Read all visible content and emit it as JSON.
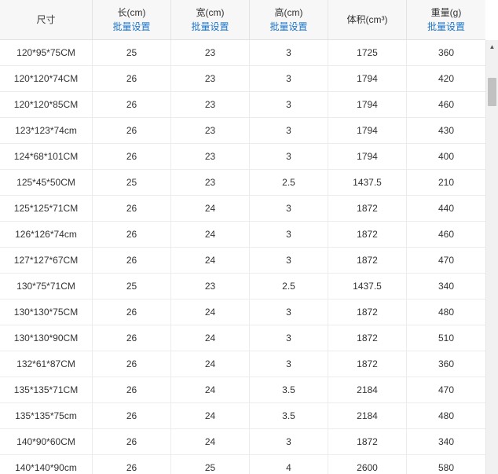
{
  "table": {
    "headers": [
      {
        "title": "尺寸",
        "link": ""
      },
      {
        "title": "长(cm)",
        "link": "批量设置"
      },
      {
        "title": "宽(cm)",
        "link": "批量设置"
      },
      {
        "title": "高(cm)",
        "link": "批量设置"
      },
      {
        "title": "体积(cm³)",
        "link": ""
      },
      {
        "title": "重量(g)",
        "link": "批量设置"
      }
    ],
    "rows": [
      [
        "120*95*75CM",
        "25",
        "23",
        "3",
        "1725",
        "360"
      ],
      [
        "120*120*74CM",
        "26",
        "23",
        "3",
        "1794",
        "420"
      ],
      [
        "120*120*85CM",
        "26",
        "23",
        "3",
        "1794",
        "460"
      ],
      [
        "123*123*74cm",
        "26",
        "23",
        "3",
        "1794",
        "430"
      ],
      [
        "124*68*101CM",
        "26",
        "23",
        "3",
        "1794",
        "400"
      ],
      [
        "125*45*50CM",
        "25",
        "23",
        "2.5",
        "1437.5",
        "210"
      ],
      [
        "125*125*71CM",
        "26",
        "24",
        "3",
        "1872",
        "440"
      ],
      [
        "126*126*74cm",
        "26",
        "24",
        "3",
        "1872",
        "460"
      ],
      [
        "127*127*67CM",
        "26",
        "24",
        "3",
        "1872",
        "470"
      ],
      [
        "130*75*71CM",
        "25",
        "23",
        "2.5",
        "1437.5",
        "340"
      ],
      [
        "130*130*75CM",
        "26",
        "24",
        "3",
        "1872",
        "480"
      ],
      [
        "130*130*90CM",
        "26",
        "24",
        "3",
        "1872",
        "510"
      ],
      [
        "132*61*87CM",
        "26",
        "24",
        "3",
        "1872",
        "360"
      ],
      [
        "135*135*71CM",
        "26",
        "24",
        "3.5",
        "2184",
        "470"
      ],
      [
        "135*135*75cm",
        "26",
        "24",
        "3.5",
        "2184",
        "480"
      ],
      [
        "140*90*60CM",
        "26",
        "24",
        "3",
        "1872",
        "340"
      ],
      [
        "140*140*90cm",
        "26",
        "25",
        "4",
        "2600",
        "580"
      ]
    ]
  },
  "scrollbar": {
    "up_icon": "triangle-up-icon"
  }
}
